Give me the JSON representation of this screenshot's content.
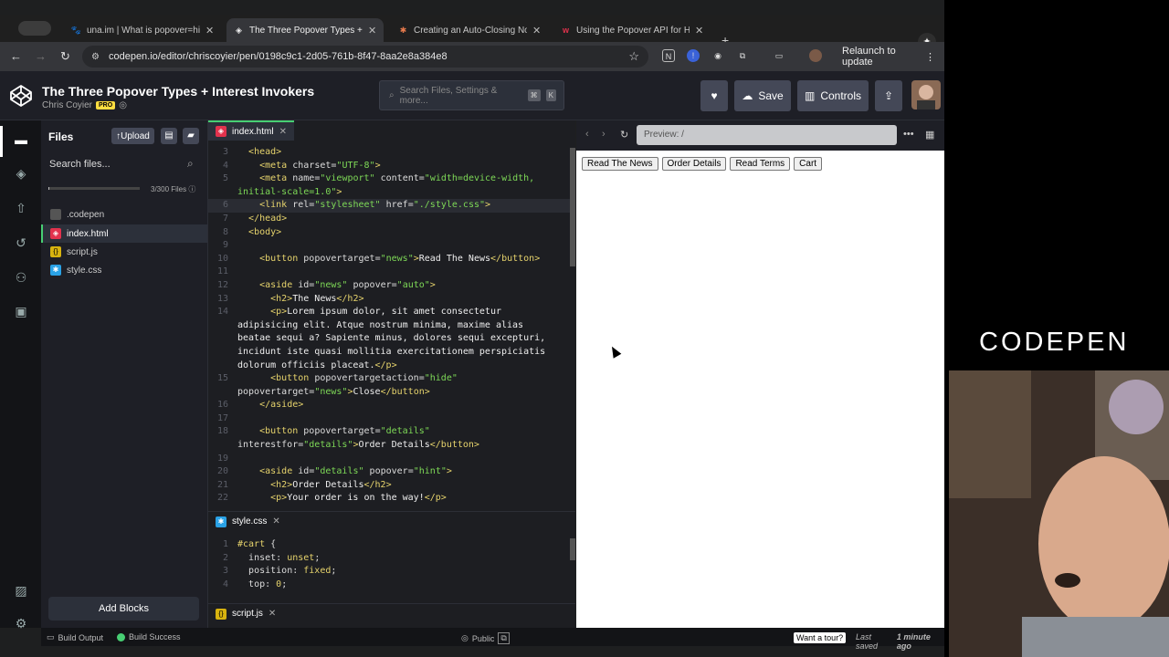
{
  "tabs": [
    {
      "title": "una.im | What is popover=hint?",
      "icon": "paw-icon"
    },
    {
      "title": "The Three Popover Types + Interest Invokers",
      "icon": "codepen-icon",
      "active": true
    },
    {
      "title": "Creating an Auto-Closing Notification",
      "icon": "asterisk-icon"
    },
    {
      "title": "Using the Popover API for HTML",
      "icon": "w-icon"
    }
  ],
  "address": {
    "url": "codepen.io/editor/chriscoyier/pen/0198c9c1-2d05-761b-8f47-8aa2e8a384e8",
    "relaunch": "Relaunch to update"
  },
  "header": {
    "title": "The Three Popover Types + Interest Invokers",
    "author": "Chris Coyier",
    "pro": "PRO",
    "search_placeholder": "Search Files, Settings & more...",
    "kbd1": "⌘",
    "kbd2": "K",
    "save": "Save",
    "controls": "Controls"
  },
  "files": {
    "title": "Files",
    "upload": "Upload",
    "search": "Search files...",
    "count": "3/300 Files",
    "usage_fraction": 0.01,
    "items": [
      {
        "name": ".codepen",
        "icon": "folder-icon",
        "color": "#666"
      },
      {
        "name": "index.html",
        "icon": "html-icon",
        "color": "#e2324d"
      },
      {
        "name": "script.js",
        "icon": "js-icon",
        "color": "#d8b30f"
      },
      {
        "name": "style.css",
        "icon": "css-icon",
        "color": "#2aa2e6"
      }
    ],
    "add_blocks": "Add Blocks"
  },
  "editor": {
    "html_tab": "index.html",
    "css_tab": "style.css",
    "js_tab": "script.js"
  },
  "preview": {
    "url": "Preview: /",
    "buttons": [
      "Read The News",
      "Order Details",
      "Read Terms",
      "Cart"
    ]
  },
  "status": {
    "build_output": "Build Output",
    "build_success": "Build Success",
    "public": "Public",
    "tour": "Want a tour?",
    "saved_prefix": "Last saved",
    "saved_time": "1 minute ago"
  },
  "brand": "CODEPEN"
}
